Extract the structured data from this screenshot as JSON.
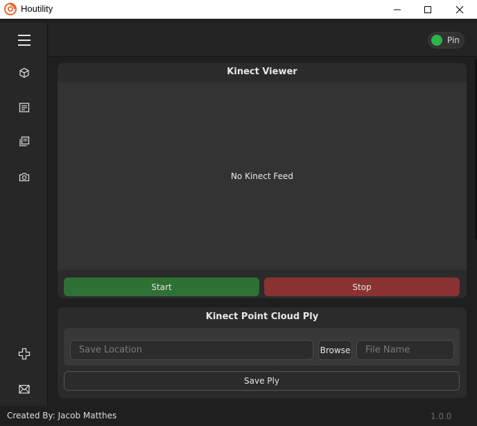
{
  "window": {
    "title": "Houtility",
    "controls": [
      "minimize",
      "maximize",
      "close"
    ]
  },
  "sidebar": {
    "items": [
      {
        "name": "menu",
        "icon": "hamburger-menu-icon"
      },
      {
        "name": "model",
        "icon": "cube-icon"
      },
      {
        "name": "document",
        "icon": "document-list-icon"
      },
      {
        "name": "copy",
        "icon": "copy-pages-icon"
      },
      {
        "name": "camera",
        "icon": "camera-icon"
      },
      {
        "name": "add",
        "icon": "plus-outline-icon"
      },
      {
        "name": "mail",
        "icon": "mail-icon"
      }
    ]
  },
  "topbar": {
    "pin_label": "Pin",
    "pin_on": true
  },
  "viewer": {
    "title": "Kinect Viewer",
    "status": "No Kinect Feed",
    "start_label": "Start",
    "stop_label": "Stop"
  },
  "ply": {
    "title": "Kinect Point Cloud Ply",
    "save_location_placeholder": "Save Location",
    "browse_label": "Browse",
    "file_name_placeholder": "File Name",
    "save_label": "Save Ply"
  },
  "footer": {
    "credit": "Created By: Jacob Matthes",
    "version": "1.0.0"
  },
  "colors": {
    "start": "#2f7034",
    "stop": "#8a3131",
    "pin_on": "#2eb34a",
    "logo": "#e8622a"
  }
}
